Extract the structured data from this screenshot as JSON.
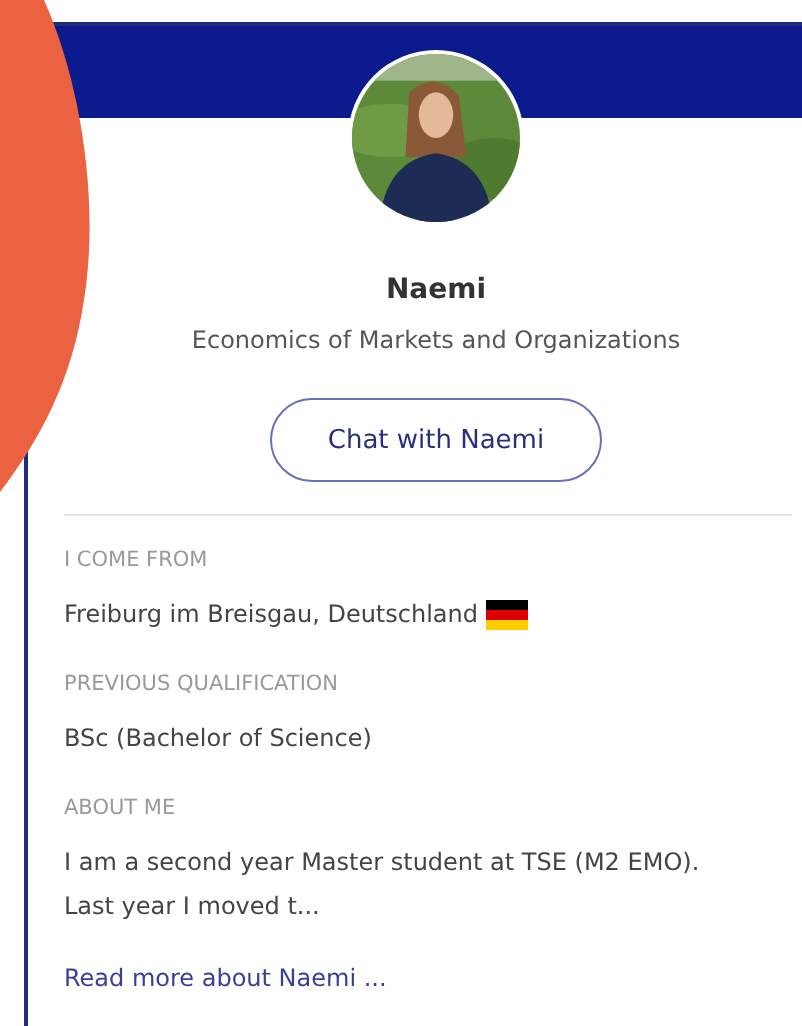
{
  "profile": {
    "name": "Naemi",
    "program": "Economics of Markets and Organizations",
    "chat_button": "Chat with Naemi",
    "fields": [
      {
        "label": "I COME FROM",
        "value": "Freiburg im Breisgau, Deutschland",
        "flag": true
      },
      {
        "label": "PREVIOUS QUALIFICATION",
        "value": "BSc (Bachelor of Science)"
      },
      {
        "label": "ABOUT ME",
        "value": "I am a second year Master student at TSE (M2 EMO). Last year I moved t..."
      }
    ],
    "read_more": "Read more about Naemi ..."
  }
}
